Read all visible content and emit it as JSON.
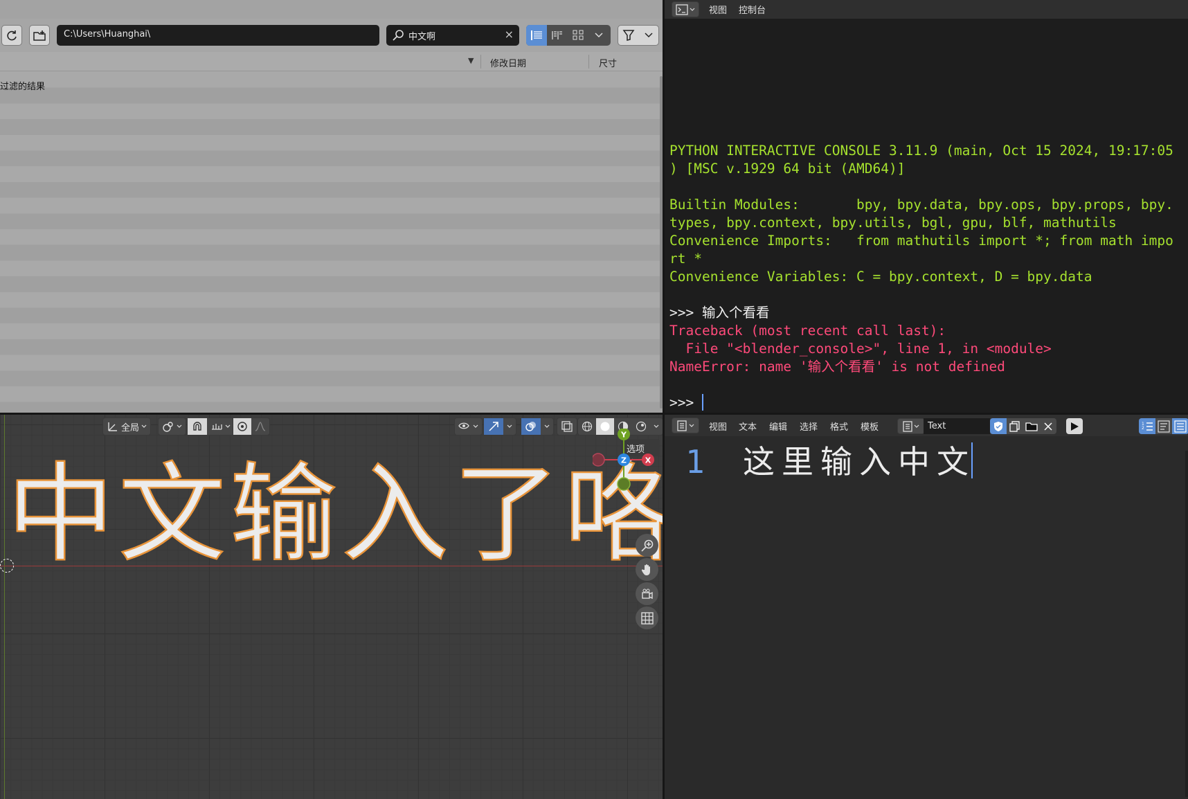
{
  "file_browser": {
    "path": "C:\\Users\\Huanghai\\",
    "search_value": "中文啊",
    "columns": {
      "date": "修改日期",
      "size": "尺寸"
    },
    "empty_message": "过滤的结果"
  },
  "console": {
    "menu": [
      "视图",
      "控制台"
    ],
    "lines": [
      {
        "text": "PYTHON INTERACTIVE CONSOLE 3.11.9 (main, Oct 15 2024, 19:17:05",
        "color": "green"
      },
      {
        "text": ") [MSC v.1929 64 bit (AMD64)]",
        "color": "green"
      },
      {
        "text": "",
        "color": "green"
      },
      {
        "text": "Builtin Modules:       bpy, bpy.data, bpy.ops, bpy.props, bpy.",
        "color": "green"
      },
      {
        "text": "types, bpy.context, bpy.utils, bgl, gpu, blf, mathutils",
        "color": "green"
      },
      {
        "text": "Convenience Imports:   from mathutils import *; from math impo",
        "color": "green"
      },
      {
        "text": "rt *",
        "color": "green"
      },
      {
        "text": "Convenience Variables: C = bpy.context, D = bpy.data",
        "color": "green"
      },
      {
        "text": "",
        "color": "green"
      },
      {
        "text": ">>> 输入个看看",
        "color": "white"
      },
      {
        "text": "Traceback (most recent call last):",
        "color": "red"
      },
      {
        "text": "  File \"<blender_console>\", line 1, in <module>",
        "color": "red"
      },
      {
        "text": "NameError: name '输入个看看' is not defined",
        "color": "red"
      },
      {
        "text": "",
        "color": "green"
      }
    ],
    "prompt": ">>> "
  },
  "viewport": {
    "orientation_label": "全局",
    "options_label": "选项",
    "text_object": "中文输入了咯",
    "gizmo": {
      "y": "Y",
      "z": "Z",
      "x": "X"
    }
  },
  "text_editor": {
    "menu": [
      "视图",
      "文本",
      "编辑",
      "选择",
      "格式",
      "模板"
    ],
    "text_name": "Text",
    "line_number": "1",
    "line_content": "这里输入中文"
  }
}
